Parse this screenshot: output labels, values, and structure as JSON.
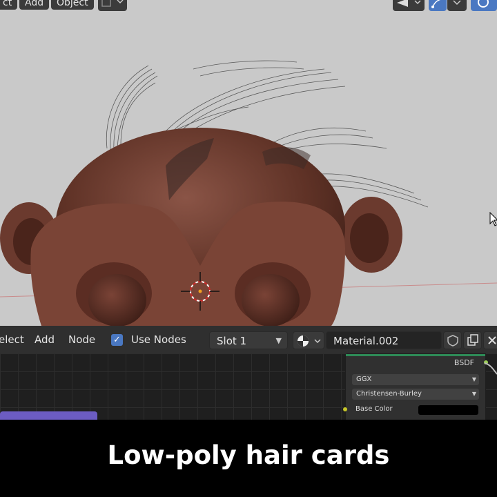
{
  "viewport_header": {
    "menu": [
      "ct",
      "Add",
      "Object"
    ]
  },
  "node_editor": {
    "header": {
      "select_label": "elect",
      "add_label": "Add",
      "node_label": "Node",
      "use_nodes_label": "Use Nodes",
      "use_nodes_checked": true,
      "slot_value": "Slot 1",
      "material_name": "Material.002"
    },
    "bsdf_node": {
      "title": "BSDF",
      "distribution": "GGX",
      "subsurface_method": "Christensen-Burley",
      "base_color_label": "Base Color",
      "base_color": "#000000"
    }
  },
  "caption": "Low-poly hair cards",
  "colors": {
    "viewport_bg": "#c9c9c9",
    "skin": "#6b3a2e",
    "accent_blue": "#4a78c2",
    "bsdf_green": "#2e8b57"
  }
}
